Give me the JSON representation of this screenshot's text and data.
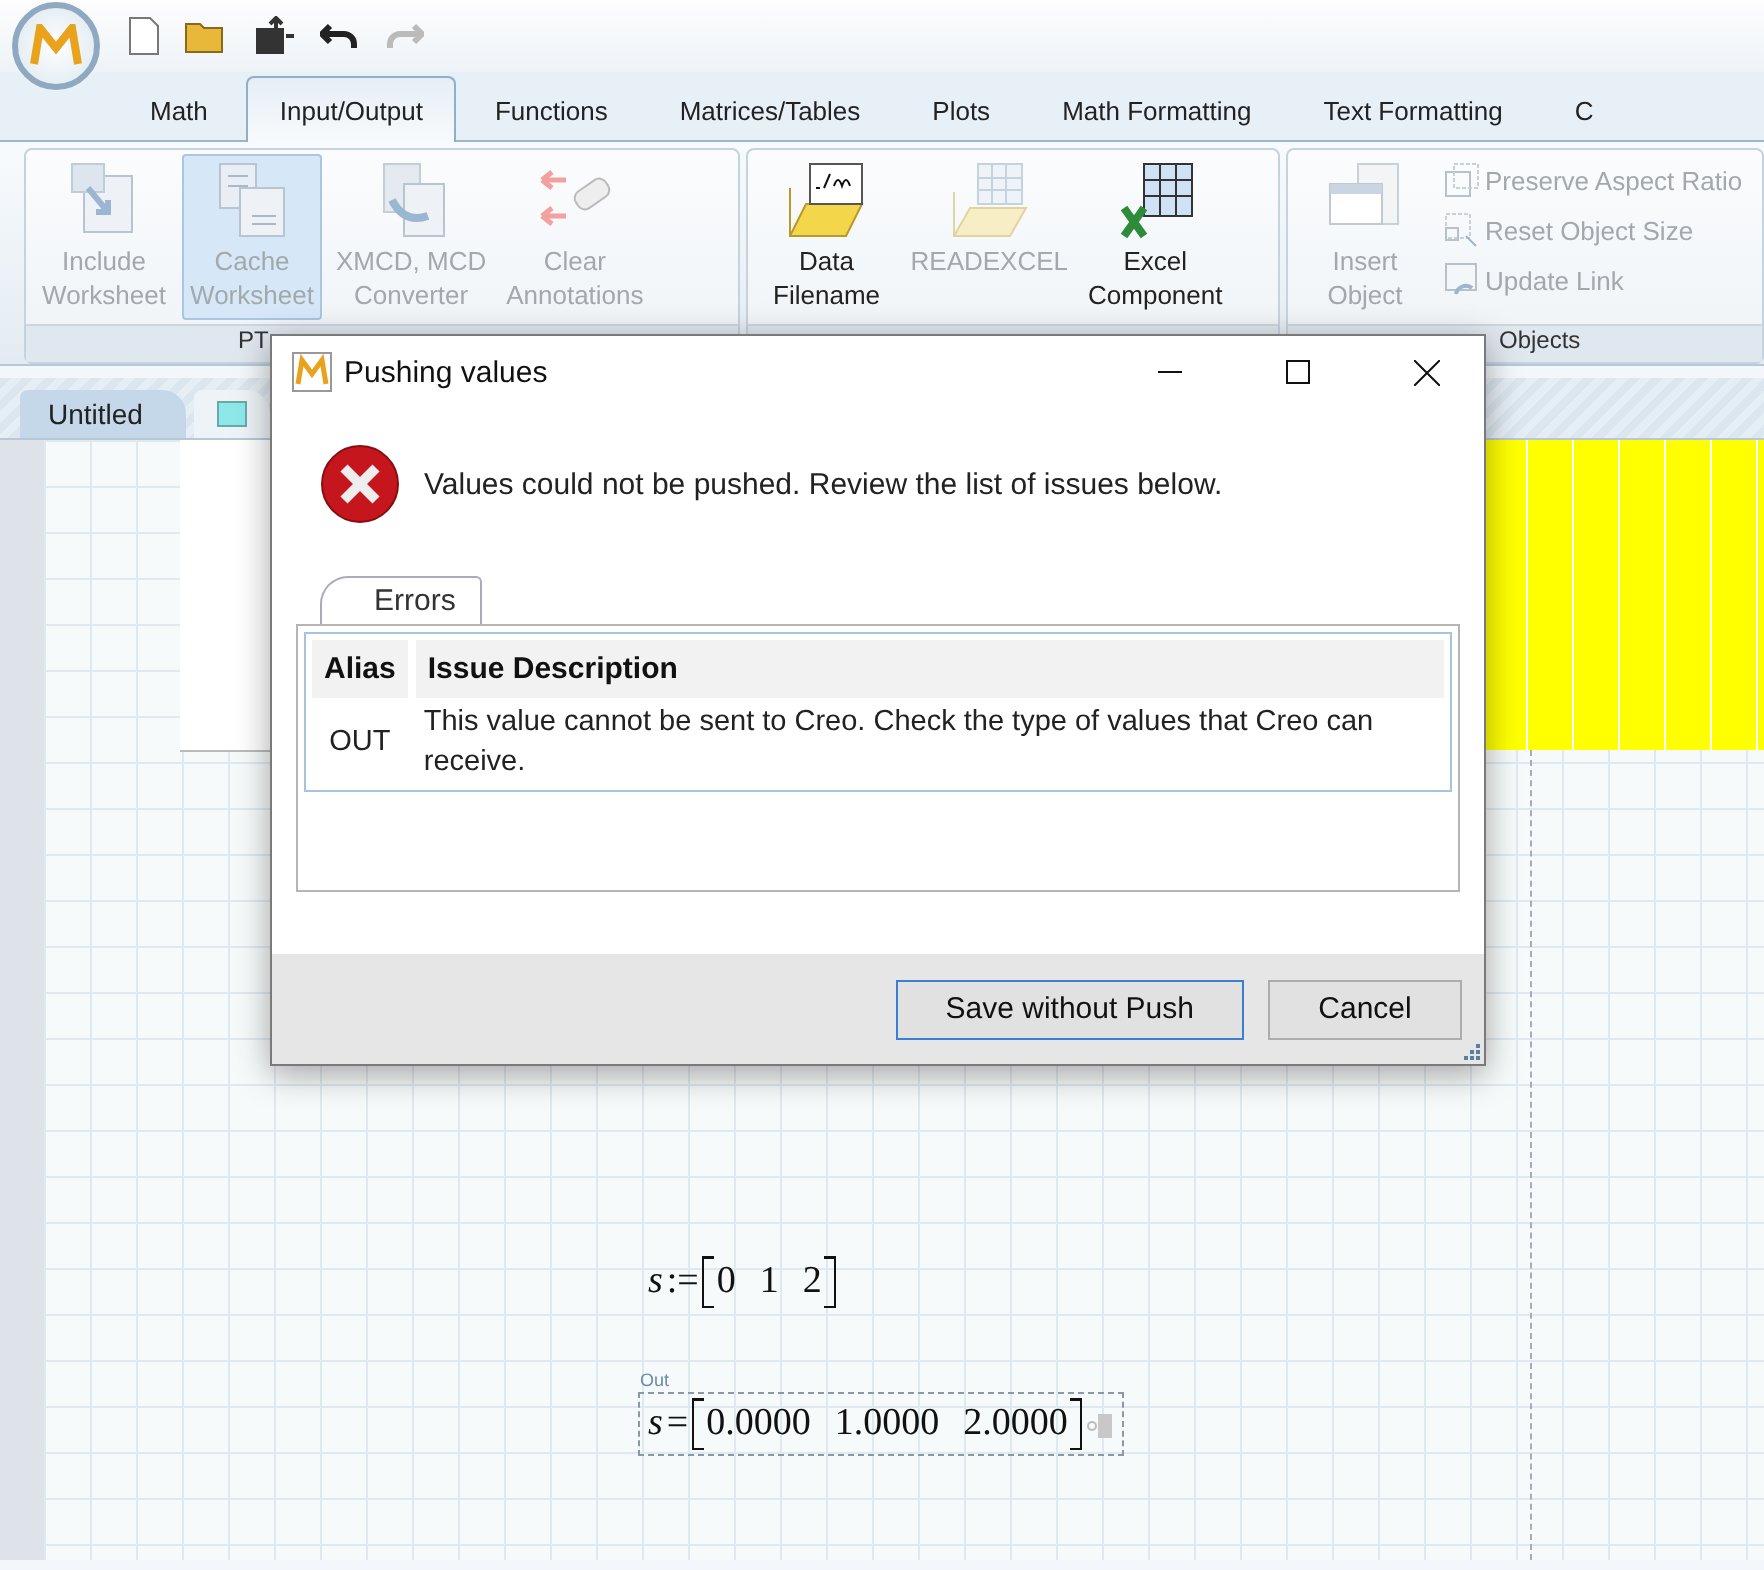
{
  "ribbon_tabs": [
    {
      "label": "Math",
      "selected": false
    },
    {
      "label": "Input/Output",
      "selected": true
    },
    {
      "label": "Functions",
      "selected": false
    },
    {
      "label": "Matrices/Tables",
      "selected": false
    },
    {
      "label": "Plots",
      "selected": false
    },
    {
      "label": "Math Formatting",
      "selected": false
    },
    {
      "label": "Text Formatting",
      "selected": false
    },
    {
      "label": "C",
      "selected": false
    }
  ],
  "ribbon_groups": [
    {
      "label": "PT",
      "buttons": [
        {
          "kind": "include",
          "label": "Include\nWorksheet",
          "disabled": true,
          "highlighted": false
        },
        {
          "kind": "cache",
          "label": "Cache\nWorksheet",
          "disabled": true,
          "highlighted": true
        },
        {
          "kind": "convert",
          "label": "XMCD, MCD\nConverter",
          "disabled": true,
          "highlighted": false
        },
        {
          "kind": "clear",
          "label": "Clear\nAnnotations",
          "disabled": true,
          "highlighted": false
        }
      ]
    },
    {
      "buttons": [
        {
          "kind": "filename",
          "label": "Data\nFilename",
          "disabled": false,
          "highlighted": false
        },
        {
          "kind": "readexcel",
          "label": "READEXCEL",
          "disabled": true,
          "highlighted": false
        },
        {
          "kind": "excel",
          "label": "Excel\nComponent",
          "disabled": false,
          "highlighted": false
        }
      ]
    },
    {
      "label": "Objects",
      "buttons": [
        {
          "kind": "object",
          "label": "Insert\nObject",
          "disabled": true,
          "highlighted": false
        }
      ],
      "side_items": [
        {
          "label": "Preserve Aspect Ratio",
          "disabled": true
        },
        {
          "label": "Reset Object Size",
          "disabled": true
        },
        {
          "label": "Update Link",
          "disabled": true
        }
      ]
    }
  ],
  "document_tabs": [
    {
      "label": "Untitled",
      "selected": true
    }
  ],
  "worksheet": {
    "definition": {
      "variable": "s",
      "operator": ":=",
      "values": [
        "0",
        "1",
        "2"
      ]
    },
    "result": {
      "tag": "Out",
      "variable": "s",
      "operator": "=",
      "values": [
        "0.0000",
        "1.0000",
        "2.0000"
      ]
    }
  },
  "dialog": {
    "title": "Pushing values",
    "message": "Values could not be pushed. Review the list of issues below.",
    "tabs": [
      {
        "label": "Errors",
        "selected": true
      }
    ],
    "table": {
      "columns": [
        "Alias",
        "Issue Description"
      ],
      "rows": [
        {
          "alias": "OUT",
          "description": "This value cannot be sent to Creo. Check the type of values that Creo can receive."
        }
      ]
    },
    "buttons": [
      {
        "label": "Save without Push",
        "default": true
      },
      {
        "label": "Cancel",
        "default": false
      }
    ]
  }
}
